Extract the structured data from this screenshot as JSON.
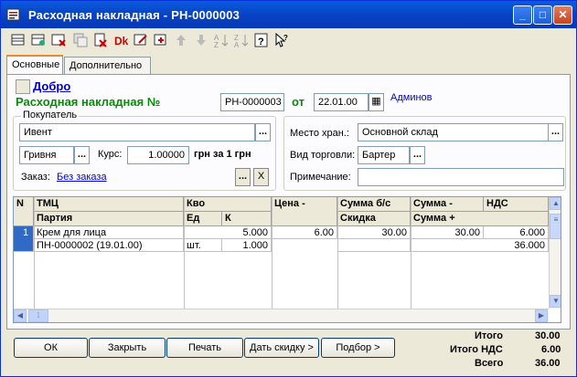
{
  "window": {
    "title": "Расходная накладная - РН-0000003"
  },
  "toolbar": {
    "icons": [
      "new-row-icon",
      "copy-row-icon",
      "delete-row-icon",
      "clone-icon",
      "mark-delete-icon",
      "unmark-icon",
      "edit-row-icon",
      "find-icon",
      "move-up-icon",
      "move-down-icon",
      "sort-asc-icon",
      "sort-desc-icon",
      "help-icon",
      "whats-this-icon"
    ]
  },
  "tabs": [
    {
      "label": "Основные"
    },
    {
      "label": "Дополнительно"
    }
  ],
  "header": {
    "status_link": "Добро",
    "doc_title": "Расходная накладная №",
    "doc_number": "РН-0000003",
    "from_label": "от",
    "doc_date": "22.01.00",
    "author": "Админов"
  },
  "buyer": {
    "group_label": "Покупатель",
    "customer": "Ивент",
    "currency": "Гривня",
    "rate_label": "Курс:",
    "rate": "1.00000",
    "rate_unit": "грн за 1 грн",
    "order_label": "Заказ:",
    "order_link": "Без заказа",
    "clear_btn": "X"
  },
  "storage": {
    "place_label": "Место хран.:",
    "place": "Основной склад",
    "trade_label": "Вид торговли:",
    "trade": "Бартер",
    "note_label": "Примечание:",
    "note": ""
  },
  "table": {
    "headers": {
      "n": "N",
      "item": "ТМЦ",
      "qty": "Кво",
      "price": "Цена -",
      "sum_no_vat": "Сумма б/с",
      "sum": "Сумма -",
      "vat": "НДС",
      "batch": "Партия",
      "unit": "Ед",
      "k": "К",
      "discount": "Скидка",
      "sum_plus": "Сумма +"
    },
    "rows": [
      {
        "n": "1",
        "item": "Крем для лица",
        "batch": "ПН-0000002 (19.01.00)",
        "qty": "5.000",
        "unit": "шт.",
        "k": "1.000",
        "price": "6.00",
        "sum_no_vat": "30.00",
        "discount": "",
        "sum": "30.00",
        "sum_plus": "",
        "vat": "6.000",
        "vat2": "36.000"
      }
    ]
  },
  "buttons": {
    "ok": "ОК",
    "close": "Закрыть",
    "print": "Печать",
    "discount": "Дать скидку >",
    "select": "Подбор >"
  },
  "totals": {
    "total_label": "Итого",
    "total": "30.00",
    "vat_label": "Итого НДС",
    "vat": "6.00",
    "all_label": "Всего",
    "all": "36.00"
  }
}
